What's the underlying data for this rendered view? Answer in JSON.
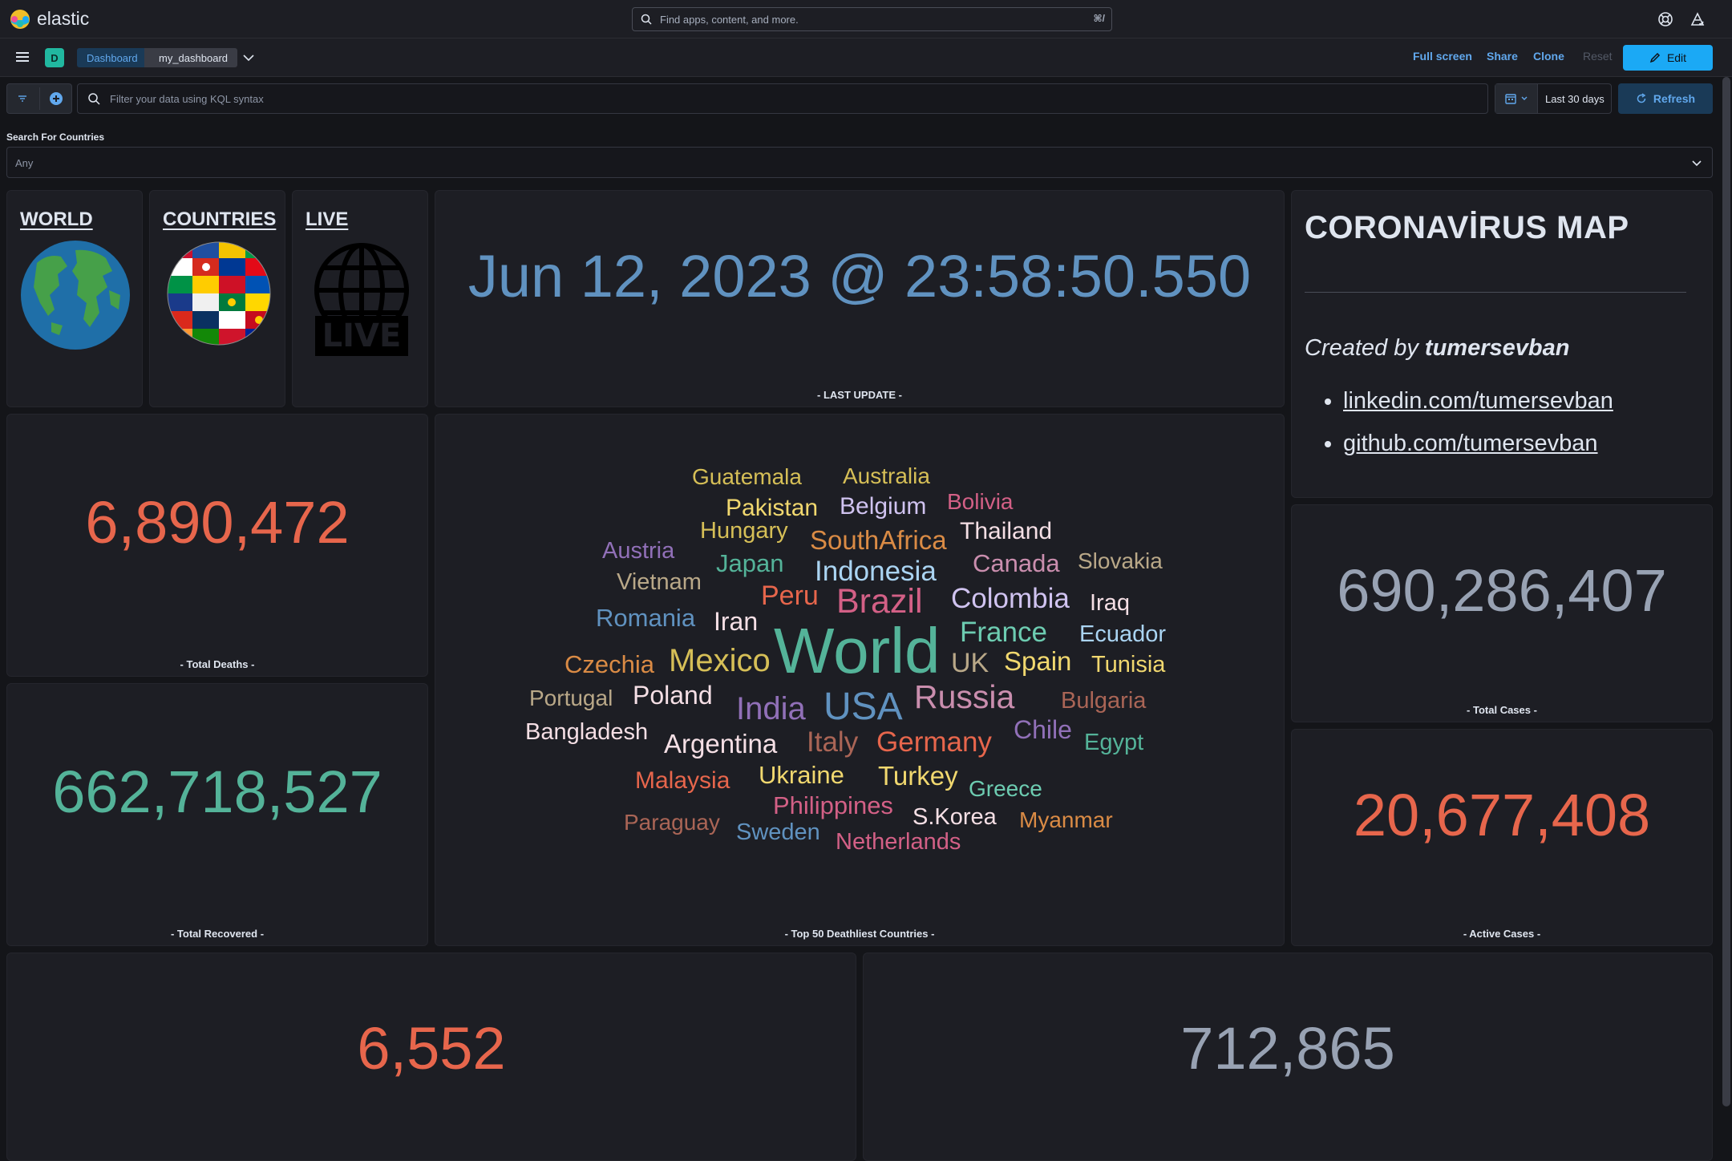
{
  "app": {
    "name": "elastic",
    "search_placeholder": "Find apps, content, and more.",
    "search_shortcut": "⌘/"
  },
  "nav": {
    "space_badge": "D",
    "breadcrumbs": [
      "Dashboard",
      "my_dashboard"
    ],
    "links": [
      "Full screen",
      "Share",
      "Clone",
      "Reset"
    ],
    "edit_label": "Edit"
  },
  "query": {
    "placeholder": "Filter your data using KQL syntax",
    "time_range": "Last 30 days",
    "refresh_label": "Refresh"
  },
  "controls": {
    "label": "Search For Countries",
    "value": "Any"
  },
  "nav_panels": {
    "world": "WORLD",
    "countries": "COUNTRIES",
    "live": "LIVE",
    "live_badge": "LIVE"
  },
  "last_update": {
    "value": "Jun 12, 2023 @ 23:58:50.550",
    "label": "- LAST UPDATE -"
  },
  "about": {
    "title": "CORONAVİRUS MAP",
    "created_prefix": "Created by",
    "author": "tumersevban",
    "links": [
      "linkedin.com/tumersevban",
      "github.com/tumersevban"
    ]
  },
  "metrics": {
    "total_deaths": {
      "value": "6,890,472",
      "label": "- Total Deaths -",
      "color": "#e7664c"
    },
    "total_recovered": {
      "value": "662,718,527",
      "label": "- Total Recovered -",
      "color": "#54b399"
    },
    "total_cases": {
      "value": "690,286,407",
      "label": "- Total Cases -",
      "color": "#98a2b3"
    },
    "active_cases": {
      "value": "20,677,408",
      "label": "- Active Cases -",
      "color": "#e7664c"
    },
    "bottom_left": {
      "value": "6,552",
      "color": "#e7664c"
    },
    "bottom_right": {
      "value": "712,865",
      "color": "#98a2b3"
    }
  },
  "word_cloud": {
    "label": "- Top 50 Deathliest Countries -",
    "words": [
      {
        "text": "Guatemala",
        "color": "#d6bf57"
      },
      {
        "text": "Australia",
        "color": "#d6bf57"
      },
      {
        "text": "Pakistan",
        "color": "#f1d86f"
      },
      {
        "text": "Belgium",
        "color": "#d0c3f0"
      },
      {
        "text": "Bolivia",
        "color": "#d36086"
      },
      {
        "text": "Hungary",
        "color": "#d6bf57"
      },
      {
        "text": "SouthAfrica",
        "color": "#da8b45"
      },
      {
        "text": "Thailand",
        "color": "#f5dfe5"
      },
      {
        "text": "Austria",
        "color": "#9170b8"
      },
      {
        "text": "Japan",
        "color": "#54b399"
      },
      {
        "text": "Indonesia",
        "color": "#aad4f2"
      },
      {
        "text": "Canada",
        "color": "#ca8eae"
      },
      {
        "text": "Slovakia",
        "color": "#b9a888"
      },
      {
        "text": "Vietnam",
        "color": "#b9a888"
      },
      {
        "text": "Peru",
        "color": "#e7664c"
      },
      {
        "text": "Brazil",
        "color": "#d36086"
      },
      {
        "text": "Colombia",
        "color": "#d0c3f0"
      },
      {
        "text": "Iraq",
        "color": "#f5dfe5"
      },
      {
        "text": "Romania",
        "color": "#6092c0"
      },
      {
        "text": "Iran",
        "color": "#f5dfe5"
      },
      {
        "text": "World",
        "color": "#54b399"
      },
      {
        "text": "France",
        "color": "#6dccb1"
      },
      {
        "text": "Ecuador",
        "color": "#aad4f2"
      },
      {
        "text": "Czechia",
        "color": "#da8b45"
      },
      {
        "text": "Mexico",
        "color": "#d6bf57"
      },
      {
        "text": "UK",
        "color": "#b9a888"
      },
      {
        "text": "Spain",
        "color": "#f1d86f"
      },
      {
        "text": "Tunisia",
        "color": "#f1d86f"
      },
      {
        "text": "Portugal",
        "color": "#b9a888"
      },
      {
        "text": "Poland",
        "color": "#f5dfe5"
      },
      {
        "text": "India",
        "color": "#9170b8"
      },
      {
        "text": "USA",
        "color": "#6092c0"
      },
      {
        "text": "Russia",
        "color": "#ca8eae"
      },
      {
        "text": "Bulgaria",
        "color": "#aa6556"
      },
      {
        "text": "Bangladesh",
        "color": "#f5dfe5"
      },
      {
        "text": "Argentina",
        "color": "#f5dfe5"
      },
      {
        "text": "Italy",
        "color": "#aa6556"
      },
      {
        "text": "Germany",
        "color": "#e7664c"
      },
      {
        "text": "Chile",
        "color": "#9170b8"
      },
      {
        "text": "Egypt",
        "color": "#54b399"
      },
      {
        "text": "Malaysia",
        "color": "#e7664c"
      },
      {
        "text": "Ukraine",
        "color": "#f1d86f"
      },
      {
        "text": "Turkey",
        "color": "#f1d86f"
      },
      {
        "text": "Greece",
        "color": "#6dccb1"
      },
      {
        "text": "Philippines",
        "color": "#d36086"
      },
      {
        "text": "Paraguay",
        "color": "#aa6556"
      },
      {
        "text": "S.Korea",
        "color": "#f5dfe5"
      },
      {
        "text": "Myanmar",
        "color": "#da8b45"
      },
      {
        "text": "Sweden",
        "color": "#6092c0"
      },
      {
        "text": "Netherlands",
        "color": "#d36086"
      }
    ]
  },
  "colors": {
    "accent": "#1ba9f5",
    "link": "#61a8ed",
    "panel_bg": "#1d1e24",
    "page_bg": "#141519"
  }
}
